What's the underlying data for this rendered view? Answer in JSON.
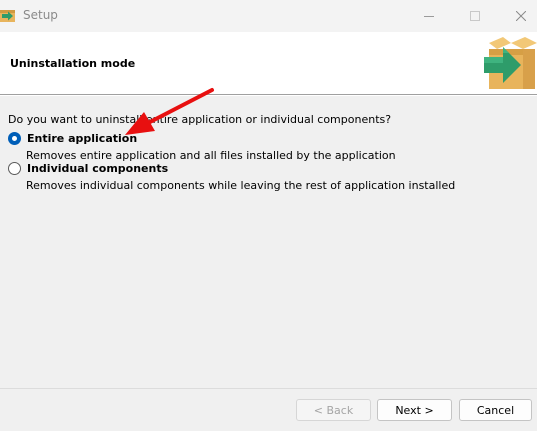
{
  "window": {
    "title": "Setup"
  },
  "header": {
    "title": "Uninstallation mode",
    "logo_icon": "box-arrow-icon"
  },
  "content": {
    "question": "Do you want to uninstall entire application or individual components?",
    "options": [
      {
        "label": "Entire application",
        "description": "Removes entire application and all files installed by the application",
        "selected": true
      },
      {
        "label": "Individual components",
        "description": "Removes individual components while leaving the rest of application installed",
        "selected": false
      }
    ]
  },
  "buttons": {
    "back": "< Back",
    "next": "Next >",
    "cancel": "Cancel"
  },
  "colors": {
    "accent": "#005fb8",
    "annotation_arrow": "#e81010",
    "logo_box": "#e8b45c",
    "logo_arrow": "#2e9c6a"
  }
}
